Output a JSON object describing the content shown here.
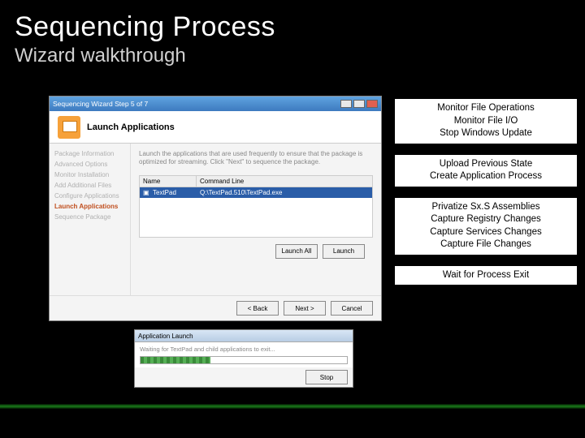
{
  "slide": {
    "title": "Sequencing Process",
    "subtitle": "Wizard walkthrough"
  },
  "notes": [
    "Monitor File Operations\nMonitor File I/O\nStop Windows Update",
    "Upload Previous State\nCreate Application Process",
    "Privatize Sx.S Assemblies\nCapture Registry Changes\nCapture Services Changes\nCapture File Changes",
    "Wait for Process Exit"
  ],
  "wizard": {
    "window_title": "Sequencing Wizard  Step 5 of 7",
    "banner_title": "Launch Applications",
    "side_items": [
      "Package Information",
      "Advanced Options",
      "Monitor Installation",
      "Add Additional Files",
      "Configure Applications",
      "Launch Applications",
      "Sequence Package"
    ],
    "active_side_index": 5,
    "description": "Launch the applications that are used frequently to ensure that the package is optimized for streaming. Click \"Next\" to sequence the package.",
    "grid": {
      "col_name": "Name",
      "col_cmd": "Command Line",
      "row_name": "TextPad",
      "row_cmd": "Q:\\TextPad.510\\TextPad.exe"
    },
    "buttons": {
      "launch_all": "Launch All",
      "launch": "Launch",
      "back": "< Back",
      "next": "Next >",
      "cancel": "Cancel"
    }
  },
  "launch_dialog": {
    "title": "Application Launch",
    "message": "Waiting for TextPad and child applications to exit...",
    "stop": "Stop"
  }
}
